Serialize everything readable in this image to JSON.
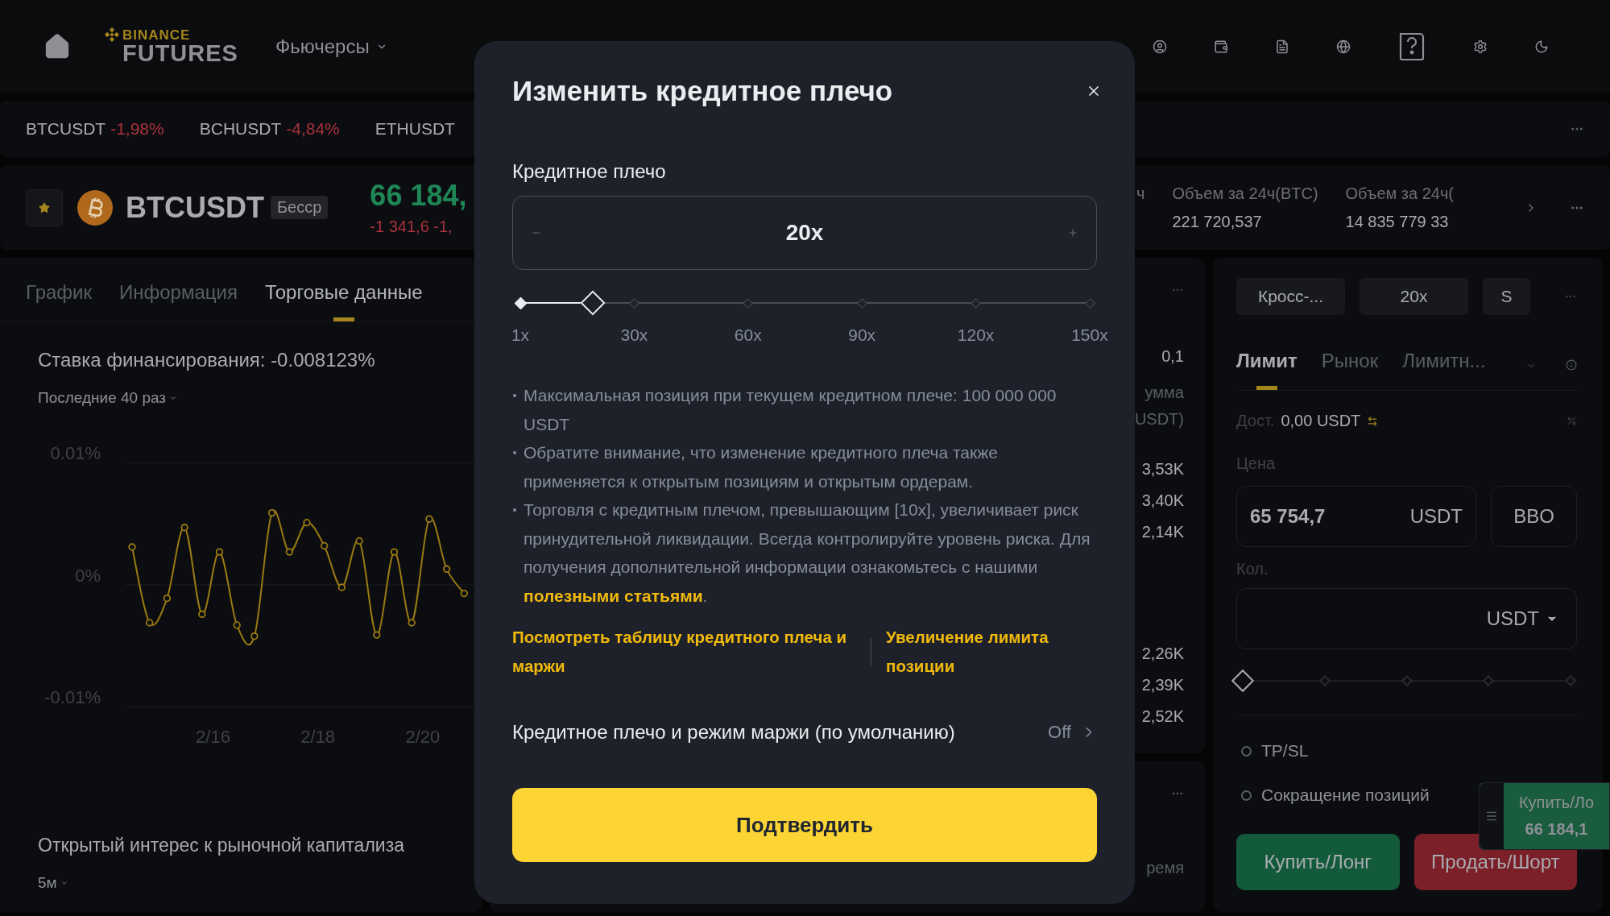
{
  "nav": {
    "logo_top": "BINANCE",
    "logo_bottom": "FUTURES",
    "items": [
      {
        "label": "Фьючерсы",
        "caret": true
      }
    ]
  },
  "ticker": [
    {
      "symbol": "BTCUSDT",
      "change": "-1,98%"
    },
    {
      "symbol": "BCHUSDT",
      "change": "-4,84%"
    },
    {
      "symbol": "ETHUSDT"
    }
  ],
  "symbol_header": {
    "symbol": "BTCUSDT",
    "contract": "Бесср",
    "price": "66 184,",
    "change": "-1 341,6 -1,",
    "stats": [
      {
        "label": "ч"
      },
      {
        "label": "Объем за 24ч(BTC)",
        "value": "221 720,537"
      },
      {
        "label": "Объем за 24ч(",
        "value": "14 835 779 33"
      }
    ]
  },
  "left_panel": {
    "tabs": [
      {
        "label": "График",
        "selected": false
      },
      {
        "label": "Информация",
        "selected": false
      },
      {
        "label": "Торговые данные",
        "selected": true
      }
    ],
    "funding_title": "Ставка финансирования: -0.008123%",
    "funding_period": "Последние 40 раз",
    "chart_data": {
      "type": "line",
      "categories": [
        null,
        null,
        null,
        null,
        null,
        "2/16",
        null,
        null,
        null,
        null,
        null,
        "2/18",
        null,
        null,
        null,
        null,
        null,
        "2/20",
        null,
        null
      ],
      "series": [
        {
          "color": "#9a7a12",
          "marker": true,
          "values": [
            0.0031,
            -0.0031,
            -0.0011,
            0.0047,
            -0.0024,
            0.0027,
            -0.0033,
            -0.0042,
            0.0059,
            0.0027,
            0.0051,
            0.0032,
            -0.0002,
            0.0036,
            -0.0041,
            0.0027,
            -0.0031,
            0.0054,
            0.0013,
            -0.0007
          ]
        }
      ],
      "ylim": [
        -0.01,
        0.01
      ],
      "yticks": [
        {
          "value": 0.01,
          "label": "0.01%"
        },
        {
          "value": 0,
          "label": "0%"
        },
        {
          "value": -0.01,
          "label": "-0.01%"
        }
      ]
    },
    "oi_title": "Открытый интерес к рыночной капитализа",
    "oi_period": "5м"
  },
  "order_book": {
    "header": [
      "0,1",
      "умма",
      "USDT)"
    ],
    "asks": [
      "3,53K",
      "3,40K",
      "2,14K"
    ],
    "bids": [
      "2,26K",
      "2,39K",
      "2,52K"
    ]
  },
  "trades_panel": {
    "column": "ремя"
  },
  "right_panel": {
    "margin_buttons": [
      "Кросс-...",
      "20x",
      "S"
    ],
    "order_tabs": [
      {
        "label": "Лимит",
        "selected": true
      },
      {
        "label": "Рынок",
        "selected": false
      },
      {
        "label": "Лимитн...",
        "selected": false
      }
    ],
    "available_label": "Дост.",
    "available": "0,00 USDT",
    "price_label": "Цена",
    "price_value": "65 754,7",
    "price_unit": "USDT",
    "bbo": "BBO",
    "qty_label": "Кол.",
    "qty_unit": "USDT",
    "slider": {
      "level": 0
    },
    "checkboxes": [
      {
        "label": "TP/SL",
        "checked": false
      },
      {
        "label": "Сокращение позиций",
        "checked": false
      }
    ],
    "buy": "Купить/Лонг",
    "sell": "Продать/Шорт"
  },
  "floating_widget": {
    "label": "Купить/Ло",
    "price": "66 184,1"
  },
  "modal": {
    "title": "Изменить кредитное плечо",
    "field_label": "Кредитное плечо",
    "value": "20x",
    "slider": {
      "level": 0.128,
      "marks": [
        "1x",
        "30x",
        "60x",
        "90x",
        "120x",
        "150x"
      ]
    },
    "notes": [
      {
        "text": "Максимальная позиция при текущем кредитном плече: 100 000 000 USDT"
      },
      {
        "text": "Обратите внимание, что изменение кредитного плеча также применяется к открытым позициям и открытым ордерам."
      },
      {
        "text": "Торговля с кредитным плечом, превышающим [10x], увеличивает риск принудительной ликвидации. Всегда контролируйте уровень риска. Для получения дополнительной информации ознакомьтесь с нашими ",
        "link": "полезными статьями",
        "after": "."
      }
    ],
    "links": [
      "Посмотреть таблицу кредитного плеча и маржи",
      "Увеличение лимита позиции"
    ],
    "default_row": {
      "label": "Кредитное плечо и режим маржи (по умолчанию)",
      "value": "Off"
    },
    "confirm": "Подтвердить"
  }
}
